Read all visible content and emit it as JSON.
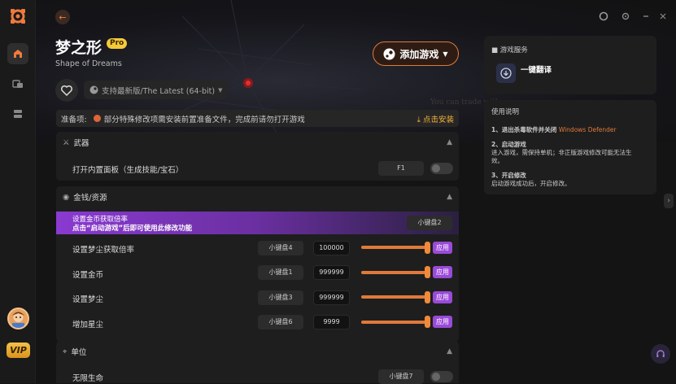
{
  "game": {
    "title": "梦之形",
    "badge": "Pro",
    "subtitle": "Shape of Dreams",
    "version": "支持最新版/The Latest (64-bit)",
    "add_button": "添加游戏"
  },
  "prep": {
    "label": "准备项:",
    "text": "部分特殊修改项需安装前置准备文件，完成前请勿打开游戏",
    "install": "点击安装"
  },
  "sections": {
    "weapons": {
      "title": "武器",
      "rows": [
        {
          "label": "打开内置面板（生成技能/宝石）",
          "key": "F1"
        }
      ]
    },
    "money": {
      "title": "金钱/资源",
      "banner_line1": "设置金币获取倍率",
      "banner_line2": "点击“启动游戏”后即可使用此修改功能",
      "banner_key": "小键盘2",
      "rows": [
        {
          "label": "设置梦尘获取倍率",
          "key": "小键盘4",
          "value": "100000",
          "apply": "应用",
          "level": 1.0
        },
        {
          "label": "设置金币",
          "key": "小键盘1",
          "value": "999999",
          "apply": "应用",
          "level": 1.0
        },
        {
          "label": "设置梦尘",
          "key": "小键盘3",
          "value": "999999",
          "apply": "应用",
          "level": 1.0
        },
        {
          "label": "增加星尘",
          "key": "小键盘6",
          "value": "9999",
          "apply": "应用",
          "level": 1.0
        }
      ]
    },
    "units": {
      "title": "单位",
      "rows": [
        {
          "label": "无限生命",
          "key": "小键盘7"
        }
      ]
    }
  },
  "services": {
    "title": "游戏服务",
    "item": "一键翻译"
  },
  "usage": {
    "title": "使用说明",
    "step1_title": "1、退出杀毒软件并关闭",
    "step1_highlight": "Windows Defender",
    "step2_title": "2、启动游戏",
    "step2_text1": "进入游戏，需保持单机；非正版游戏修改可能无法生",
    "step2_text2": "效。",
    "step3_title": "3、开启修改",
    "step3_text": "启动游戏成功后，开启修改。"
  },
  "vip": "VIP",
  "colors": {
    "accent": "#e07a3a",
    "purple": "#9a4ad8",
    "gold": "#f5c93a"
  }
}
